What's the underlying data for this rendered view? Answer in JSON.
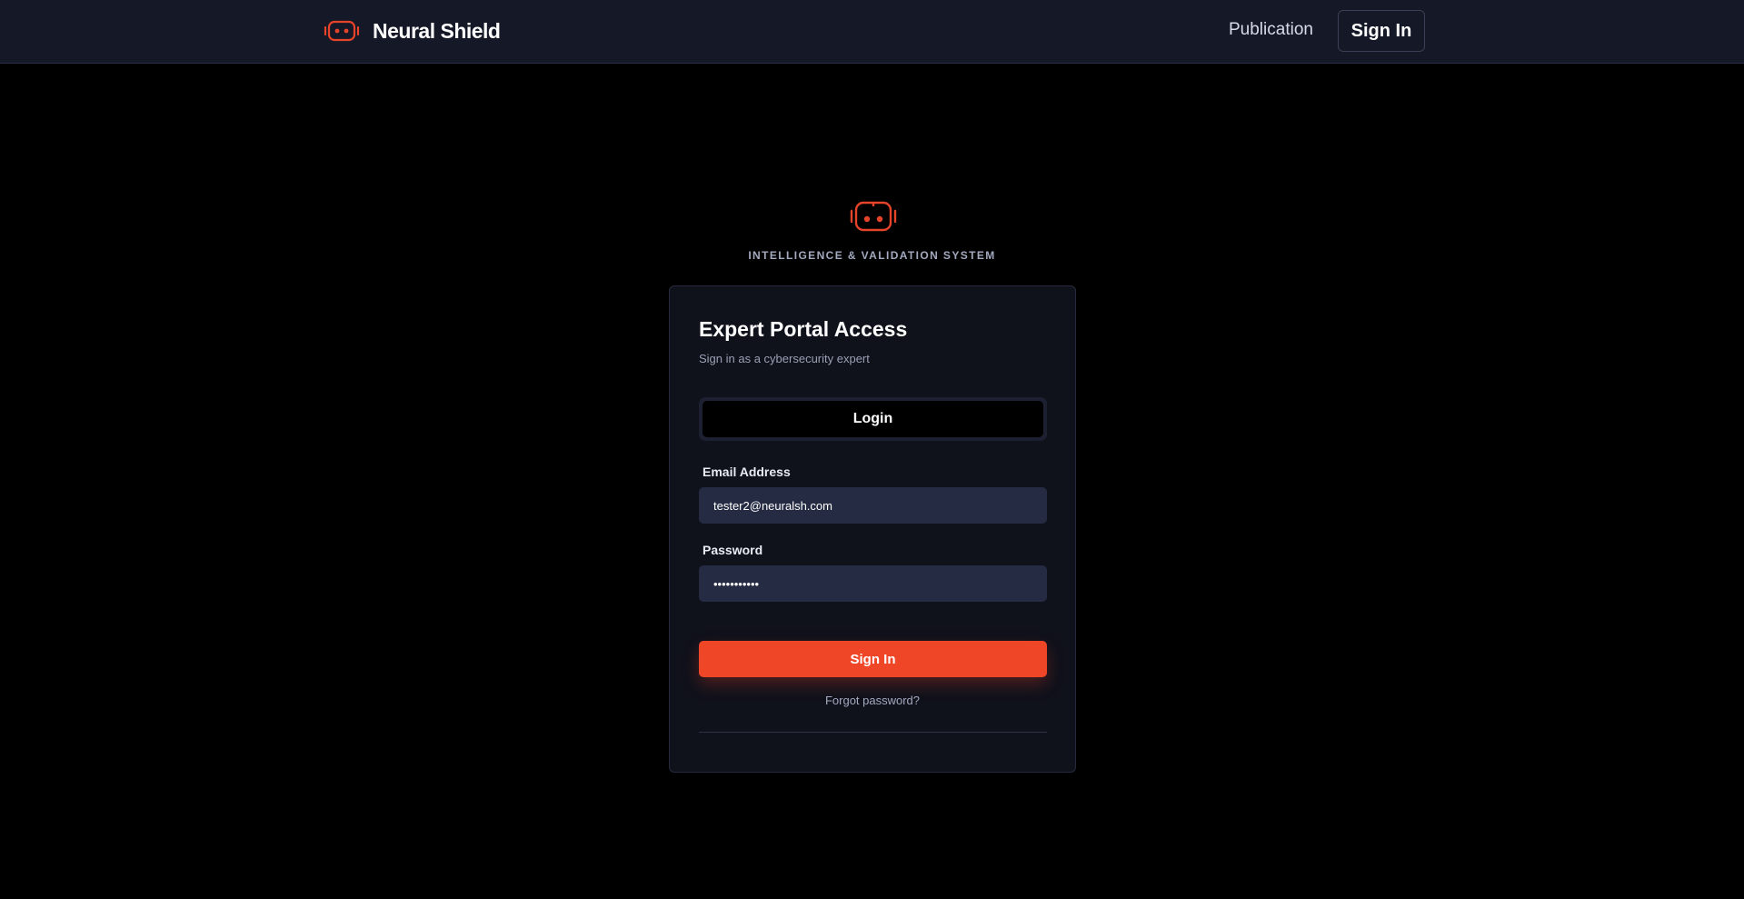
{
  "header": {
    "brand_name": "Neural Shield",
    "nav": {
      "publication_label": "Publication",
      "signin_label": "Sign In"
    }
  },
  "hero": {
    "tagline": "INTELLIGENCE & VALIDATION SYSTEM"
  },
  "card": {
    "title": "Expert Portal Access",
    "subtitle": "Sign in as a cybersecurity expert",
    "tab_label": "Login",
    "email": {
      "label": "Email Address",
      "value": "tester2@neuralsh.com"
    },
    "password": {
      "label": "Password",
      "value": "•••••••••••"
    },
    "submit_label": "Sign In",
    "forgot_label": "Forgot password?"
  },
  "colors": {
    "accent": "#f04628",
    "header_bg": "#151826",
    "card_bg": "#0f111b",
    "input_bg": "#252b42",
    "page_bg": "#000000"
  },
  "icons": {
    "brand": "robot-icon",
    "hero": "robot-icon"
  }
}
